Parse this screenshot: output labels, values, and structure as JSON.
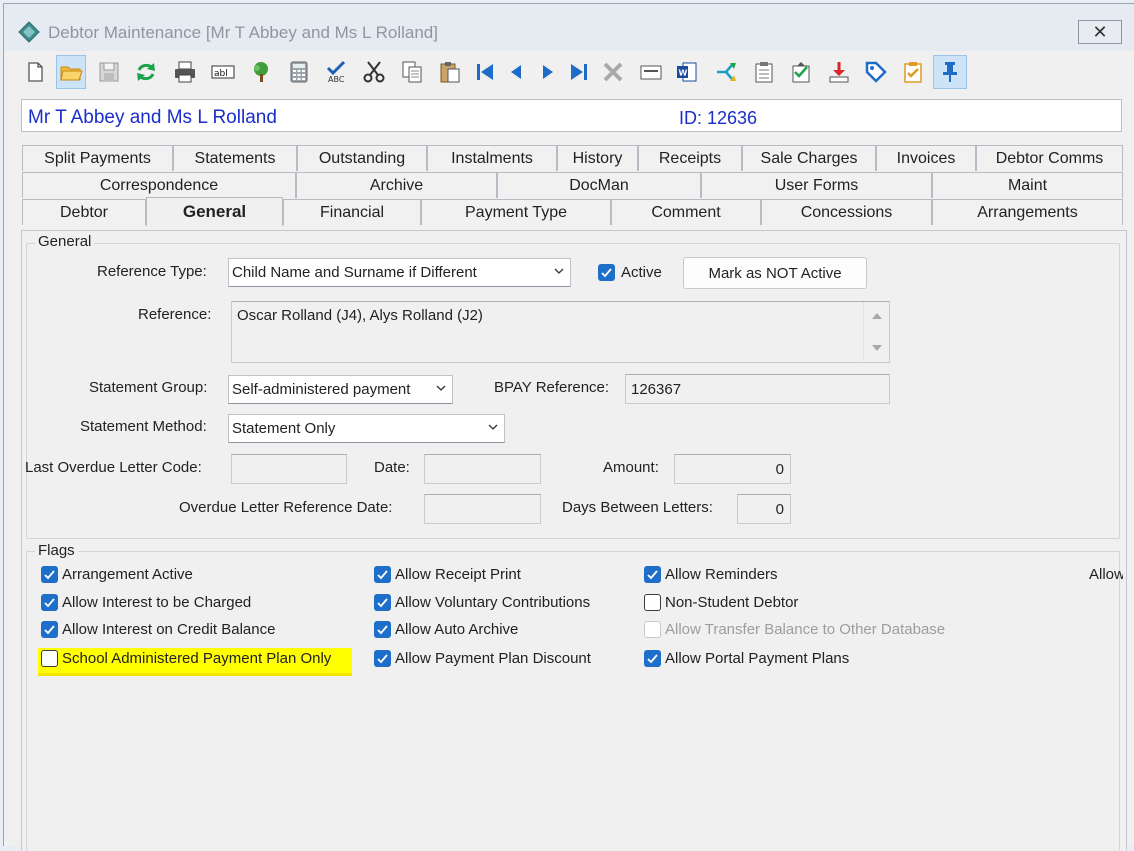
{
  "window": {
    "title": "Debtor Maintenance  [Mr T Abbey and Ms L Rolland]",
    "close_glyph": "✕"
  },
  "toolbar": {
    "icons": [
      "new-icon",
      "open-icon",
      "save-icon",
      "refresh-icon",
      "print-icon",
      "text-field-icon",
      "tree-icon",
      "calculator-icon",
      "spellcheck-icon",
      "cut-icon",
      "copy-icon",
      "paste-icon",
      "first-record-icon",
      "previous-record-icon",
      "next-record-icon",
      "last-record-icon",
      "delete-icon",
      "card-icon",
      "word-icon",
      "merge-icon",
      "clipboard-list-icon",
      "clipboard-check-icon",
      "download-icon",
      "tag-icon",
      "checklist-icon",
      "pin-icon"
    ]
  },
  "debtor": {
    "name": "Mr T Abbey and Ms L Rolland",
    "id_label": "ID: 12636"
  },
  "tabs": {
    "row1": [
      "Split Payments",
      "Statements",
      "Outstanding",
      "Instalments",
      "History",
      "Receipts",
      "Sale Charges",
      "Invoices",
      "Debtor Comms"
    ],
    "row2": [
      "Correspondence",
      "Archive",
      "DocMan",
      "User Forms",
      "Maint"
    ],
    "row3": [
      "Debtor",
      "General",
      "Financial",
      "Payment Type",
      "Comment",
      "Concessions",
      "Arrangements"
    ],
    "selected": "General"
  },
  "general": {
    "group_label": "General",
    "reference_type_label": "Reference Type:",
    "reference_type_value": "Child Name and Surname if Different",
    "active_label": "Active",
    "mark_not_active_button": "Mark as NOT Active",
    "reference_label": "Reference:",
    "reference_value": "Oscar Rolland (J4), Alys Rolland (J2)",
    "statement_group_label": "Statement Group:",
    "statement_group_value": "Self-administered payment",
    "bpay_label": "BPAY Reference:",
    "bpay_value": "126367",
    "statement_method_label": "Statement Method:",
    "statement_method_value": "Statement Only",
    "last_overdue_label": "Last Overdue Letter Code:",
    "last_overdue_value": "",
    "date_label": "Date:",
    "date_value": "",
    "amount_label": "Amount:",
    "amount_value": "0",
    "overdue_ref_date_label": "Overdue Letter Reference Date:",
    "overdue_ref_date_value": "",
    "days_between_label": "Days Between Letters:",
    "days_between_value": "0"
  },
  "flags": {
    "group_label": "Flags",
    "col1": [
      {
        "label": "Arrangement Active",
        "state": "checked"
      },
      {
        "label": "Allow Interest to be Charged",
        "state": "checked"
      },
      {
        "label": "Allow Interest on Credit Balance",
        "state": "checked"
      },
      {
        "label": "School Administered Payment Plan Only",
        "state": "unchecked"
      }
    ],
    "col2": [
      {
        "label": "Allow Receipt Print",
        "state": "checked"
      },
      {
        "label": "Allow Voluntary Contributions",
        "state": "checked"
      },
      {
        "label": "Allow Auto Archive",
        "state": "checked"
      },
      {
        "label": "Allow Payment Plan Discount",
        "state": "checked"
      }
    ],
    "col3": [
      {
        "label": "Allow Reminders",
        "state": "checked"
      },
      {
        "label": "Non-Student Debtor",
        "state": "unchecked"
      },
      {
        "label": "Allow Transfer Balance to Other Database",
        "state": "disabled"
      },
      {
        "label": "Allow Portal Payment Plans",
        "state": "checked"
      }
    ],
    "col4_partial": "Allow"
  },
  "colors": {
    "accent_blue": "#1d6fc9",
    "name_blue": "#1b2ecc",
    "highlight": "#ffff00"
  }
}
